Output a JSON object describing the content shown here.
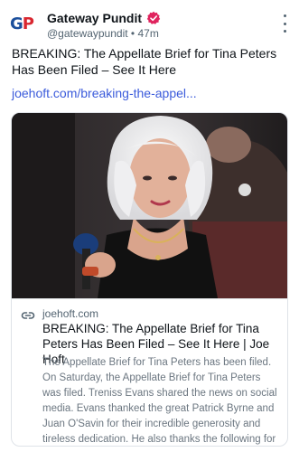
{
  "header": {
    "logo_text": "GP",
    "display_name": "Gateway Pundit",
    "handle": "@gatewaypundit",
    "separator": "•",
    "timestamp": "47m",
    "verified_icon": "verified-badge-icon",
    "more_icon": "more-vertical-icon"
  },
  "post": {
    "text": "BREAKING: The Appellate Brief for Tina Peters Has Been Filed – See It Here",
    "link_text": "joehoft.com/breaking-the-appel..."
  },
  "card": {
    "link_icon": "link-icon",
    "domain": "joehoft.com",
    "title": "BREAKING: The Appellate Brief for Tina Peters Has Been Filed – See It Here | Joe Hoft",
    "description": "The Appellate Brief for Tina Peters has been filed. On Saturday, the Appellate Brief for Tina Peters was filed. Treniss Evans shared the news on social media. Evans thanked the great Patrick Byrne and Juan O'Savin for their incredible generosity and tireless dedication. He also thanks the following for their work in putting it together"
  },
  "colors": {
    "link_blue": "#3b5bdb",
    "verified_red": "#e0245e",
    "logo_blue": "#1b4f9c",
    "logo_red": "#d9262f",
    "muted_text": "#536471"
  }
}
